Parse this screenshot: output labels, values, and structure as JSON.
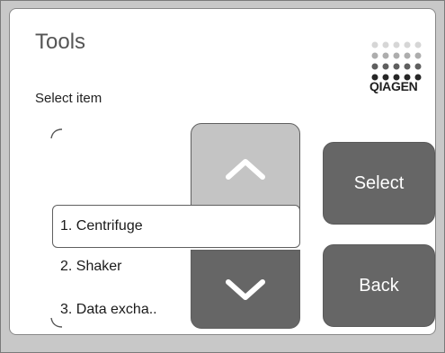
{
  "screen": {
    "title": "Tools",
    "subtitle": "Select item"
  },
  "brand": {
    "logo_text": "QIAGEN",
    "logo_icon": "qiagen-dot-logo-icon"
  },
  "list": {
    "items": [
      {
        "label": "1. Centrifuge",
        "selected": true
      },
      {
        "label": "2. Shaker",
        "selected": false
      },
      {
        "label": "3. Data excha..",
        "selected": false
      }
    ]
  },
  "actions": {
    "select_label": "Select",
    "back_label": "Back"
  },
  "icons": {
    "scroll_up": "chevron-up-icon",
    "scroll_down": "chevron-down-icon"
  },
  "colors": {
    "background": "#c8c8c8",
    "panel": "#ffffff",
    "button_dark": "#666666",
    "button_light": "#c4c4c4"
  }
}
